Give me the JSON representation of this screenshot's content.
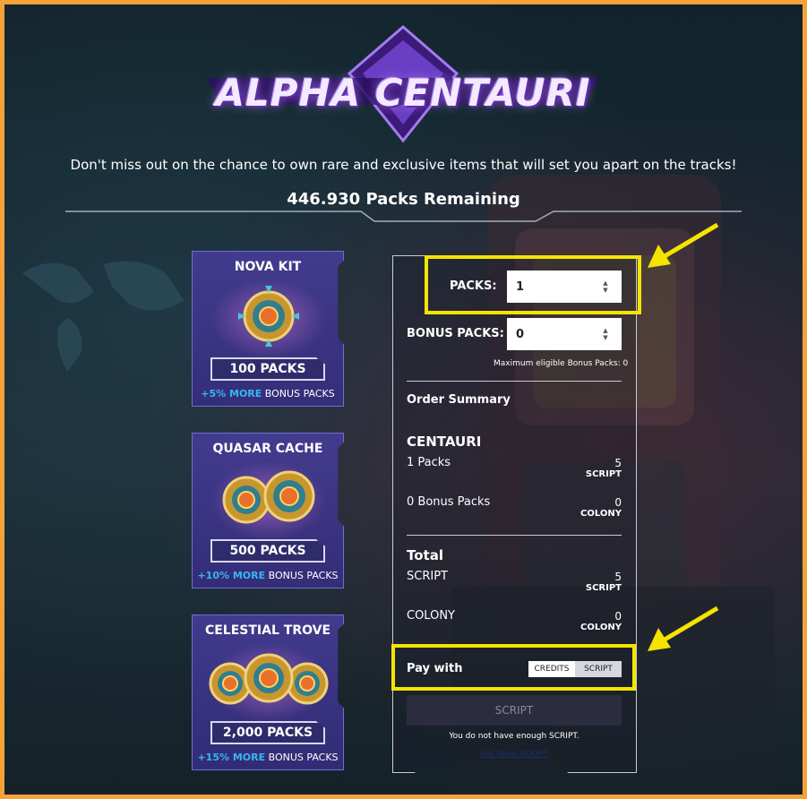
{
  "logo": {
    "text": "ALPHA CENTAURI"
  },
  "tagline": "Don't miss out on the chance to own rare and exclusive items that will set you apart on the tracks!",
  "packs_remaining": "446.930 Packs Remaining",
  "cards": [
    {
      "title": "NOVA KIT",
      "packs": "100 PACKS",
      "bonus_pct": "+5% MORE",
      "bonus_text": "BONUS PACKS",
      "gear_count": 1
    },
    {
      "title": "QUASAR CACHE",
      "packs": "500 PACKS",
      "bonus_pct": "+10% MORE",
      "bonus_text": "BONUS PACKS",
      "gear_count": 2
    },
    {
      "title": "CELESTIAL TROVE",
      "packs": "2,000 PACKS",
      "bonus_pct": "+15% MORE",
      "bonus_text": "BONUS PACKS",
      "gear_count": 3
    }
  ],
  "order": {
    "packs_label": "PACKS:",
    "packs_value": "1",
    "bonus_label": "BONUS PACKS:",
    "bonus_value": "0",
    "max_bonus_note": "Maximum eligible Bonus Packs: 0",
    "summary_title": "Order Summary",
    "product_name": "CENTAURI",
    "line1_label": "1 Packs",
    "line1_value": "5",
    "line1_unit": "SCRIPT",
    "line2_label": "0 Bonus Packs",
    "line2_value": "0",
    "line2_unit": "COLONY",
    "total_title": "Total",
    "total1_label": "SCRIPT",
    "total1_value": "5",
    "total1_unit": "SCRIPT",
    "total2_label": "COLONY",
    "total2_value": "0",
    "total2_unit": "COLONY",
    "pay_with_label": "Pay with",
    "pay_options": [
      "CREDITS",
      "SCRIPT"
    ],
    "pay_selected": "SCRIPT",
    "pay_button": "SCRIPT",
    "warning": "You do not have enough SCRIPT.",
    "get_more_link": "Get More SCRIPT"
  },
  "colors": {
    "frame_border": "#f5a238",
    "highlight": "#f4e400",
    "bonus_accent": "#36b6f2"
  }
}
